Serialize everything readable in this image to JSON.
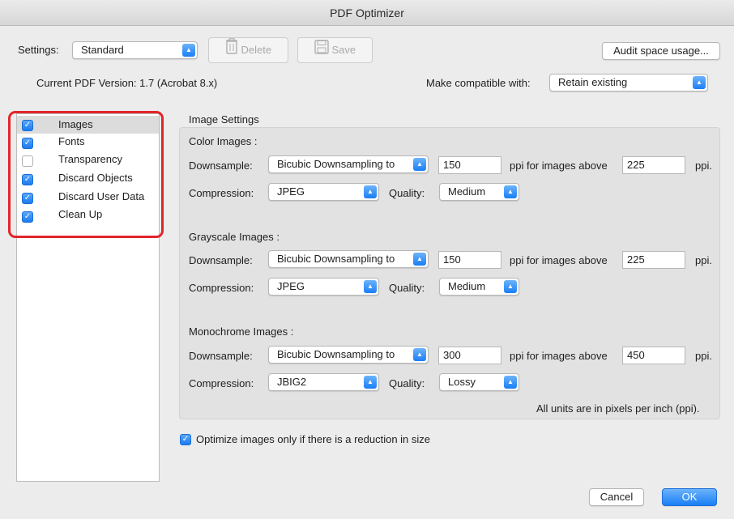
{
  "window": {
    "title": "PDF Optimizer"
  },
  "toolbar": {
    "settings_label": "Settings:",
    "settings_value": "Standard",
    "delete_label": "Delete",
    "save_label": "Save",
    "audit_label": "Audit space usage..."
  },
  "version": {
    "current_text": "Current PDF Version: 1.7 (Acrobat 8.x)",
    "compat_label": "Make compatible with:",
    "compat_value": "Retain existing"
  },
  "sidebar": {
    "items": [
      {
        "label": "Images",
        "checked": true,
        "selected": true
      },
      {
        "label": "Fonts",
        "checked": true,
        "selected": false
      },
      {
        "label": "Transparency",
        "checked": false,
        "selected": false
      },
      {
        "label": "Discard Objects",
        "checked": true,
        "selected": false
      },
      {
        "label": "Discard User Data",
        "checked": true,
        "selected": false
      },
      {
        "label": "Clean Up",
        "checked": true,
        "selected": false
      }
    ]
  },
  "image_settings": {
    "heading": "Image Settings",
    "downsample_label": "Downsample:",
    "compression_label": "Compression:",
    "quality_label": "Quality:",
    "above_label": "ppi for images above",
    "ppi_label": "ppi.",
    "color": {
      "title": "Color Images :",
      "downsample": "Bicubic Downsampling to",
      "ppi": "150",
      "above": "225",
      "compression": "JPEG",
      "quality": "Medium"
    },
    "grayscale": {
      "title": "Grayscale Images :",
      "downsample": "Bicubic Downsampling to",
      "ppi": "150",
      "above": "225",
      "compression": "JPEG",
      "quality": "Medium"
    },
    "monochrome": {
      "title": "Monochrome Images :",
      "downsample": "Bicubic Downsampling to",
      "ppi": "300",
      "above": "450",
      "compression": "JBIG2",
      "quality": "Lossy"
    },
    "units_note": "All units are in pixels per inch (ppi).",
    "optimize_only_label": "Optimize images only if there is a reduction in size",
    "optimize_only_checked": true
  },
  "footer": {
    "cancel_label": "Cancel",
    "ok_label": "OK"
  },
  "colors": {
    "accent": "#1a7ef6",
    "highlight": "#e3242b"
  }
}
